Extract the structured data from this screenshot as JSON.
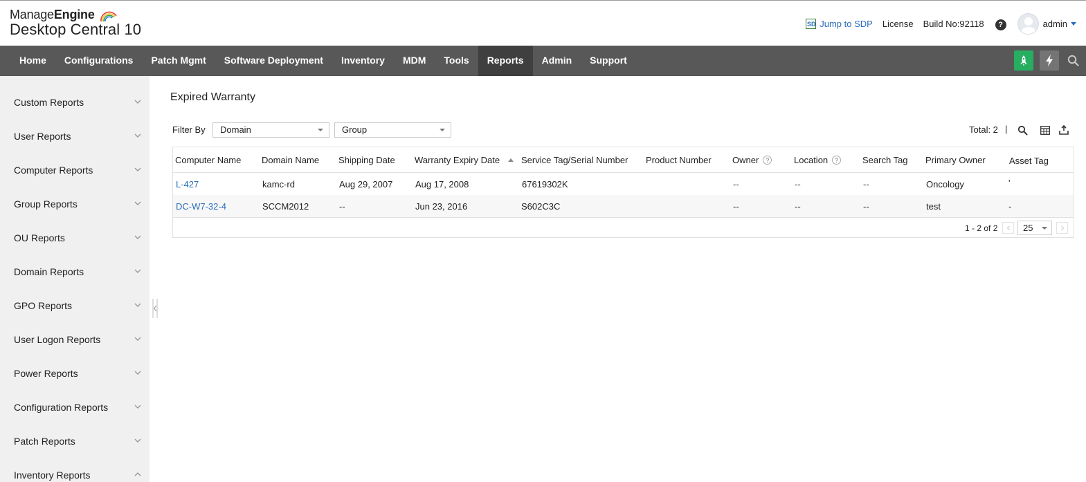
{
  "brand": {
    "name_prefix": "Manage",
    "name_suffix": "Engine",
    "product": "Desktop Central 10"
  },
  "header": {
    "jump_label": "Jump to SDP",
    "license_label": "License",
    "build_label": "Build No:92118",
    "help_label": "?",
    "user_name": "admin"
  },
  "nav": {
    "items": [
      {
        "label": "Home"
      },
      {
        "label": "Configurations"
      },
      {
        "label": "Patch Mgmt"
      },
      {
        "label": "Software Deployment"
      },
      {
        "label": "Inventory"
      },
      {
        "label": "MDM"
      },
      {
        "label": "Tools"
      },
      {
        "label": "Reports",
        "active": true
      },
      {
        "label": "Admin"
      },
      {
        "label": "Support"
      }
    ],
    "colors": {
      "bar": "#585858",
      "active": "#3f3f3f",
      "rocket": "#27ae60"
    }
  },
  "sidebar": {
    "items": [
      {
        "label": "Custom Reports",
        "expanded": false
      },
      {
        "label": "User Reports",
        "expanded": false
      },
      {
        "label": "Computer Reports",
        "expanded": false
      },
      {
        "label": "Group Reports",
        "expanded": false
      },
      {
        "label": "OU Reports",
        "expanded": false
      },
      {
        "label": "Domain Reports",
        "expanded": false
      },
      {
        "label": "GPO Reports",
        "expanded": false
      },
      {
        "label": "User Logon Reports",
        "expanded": false
      },
      {
        "label": "Power Reports",
        "expanded": false
      },
      {
        "label": "Configuration Reports",
        "expanded": false
      },
      {
        "label": "Patch Reports",
        "expanded": false
      },
      {
        "label": "Inventory Reports",
        "expanded": true
      }
    ]
  },
  "main": {
    "title": "Expired Warranty",
    "filter_label": "Filter By",
    "filters": {
      "domain": "Domain",
      "group": "Group"
    },
    "total_label": "Total: 2",
    "separator": "|",
    "columns": [
      {
        "label": "Computer Name"
      },
      {
        "label": "Domain Name"
      },
      {
        "label": "Shipping Date"
      },
      {
        "label": "Warranty Expiry Date",
        "sorted": "asc"
      },
      {
        "label": "Service Tag/Serial Number"
      },
      {
        "label": "Product Number"
      },
      {
        "label": "Owner",
        "help": true
      },
      {
        "label": "Location",
        "help": true
      },
      {
        "label": "Search Tag"
      },
      {
        "label": "Primary Owner"
      },
      {
        "label": "Asset Tag"
      }
    ],
    "rows": [
      [
        "L-427",
        "kamc-rd",
        "Aug 29, 2007",
        "Aug 17, 2008",
        "67619302K",
        "",
        "--",
        "--",
        "--",
        "Oncology",
        "'"
      ],
      [
        "DC-W7-32-4",
        "SCCM2012",
        "--",
        "Jun 23, 2016",
        "S602C3C",
        "",
        "--",
        "--",
        "--",
        "test",
        "-"
      ]
    ],
    "pagination": {
      "range": "1 - 2 of 2",
      "per_page": "25"
    }
  },
  "colors": {
    "link": "#2a6ebb",
    "sidebar_bg": "#f0f0f0"
  }
}
